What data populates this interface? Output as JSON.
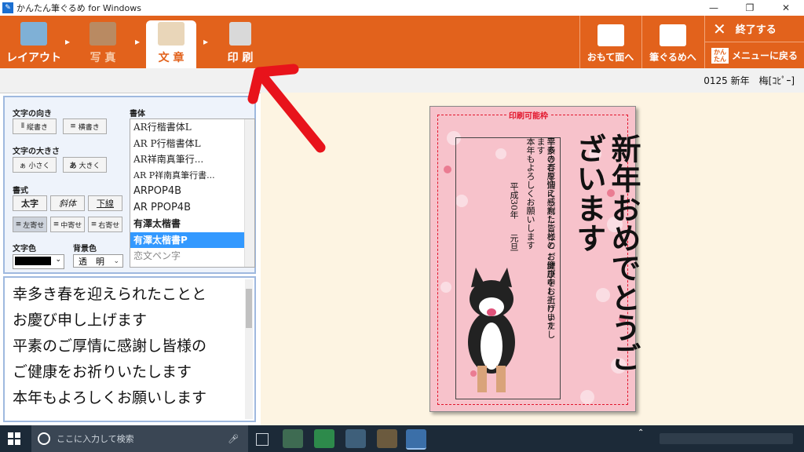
{
  "window": {
    "title": "かんたん筆ぐるめ for Windows",
    "controls": [
      "—",
      "❐",
      "✕"
    ]
  },
  "toolbar": {
    "tabs": [
      {
        "label": "レイアウト",
        "state": "normal"
      },
      {
        "label": "写 真",
        "state": "dim"
      },
      {
        "label": "文 章",
        "state": "active"
      },
      {
        "label": "印 刷",
        "state": "normal"
      }
    ],
    "right_buttons": {
      "front": "おもて面へ",
      "fude": "筆ぐるめへ",
      "exit": "終了する",
      "menu_badge": "かんたん",
      "menu": "メニューに戻る"
    }
  },
  "status": {
    "doc_name": "0125 新年　梅[ｺﾋﾟｰ]"
  },
  "left_panel": {
    "direction_label": "文字の向き",
    "vertical": "縦書き",
    "horizontal": "横書き",
    "size_label": "文字の大きさ",
    "smaller": "小さく",
    "larger": "大きく",
    "style_label": "書式",
    "bold": "太字",
    "italic": "斜体",
    "underline": "下線",
    "align_left": "左寄せ",
    "align_center": "中寄せ",
    "align_right": "右寄せ",
    "color_label": "文字色",
    "bg_label": "背景色",
    "bg_value": "透　明",
    "font_label": "書体",
    "fonts": [
      "AR行楷書体L",
      "AR P行楷書体L",
      "AR祥南真筆行...",
      "AR P祥南真筆行書...",
      "ARPOP4B",
      "AR PPOP4B",
      "有澤太楷書",
      "有澤太楷書P",
      "恋文ペン字"
    ],
    "selected_font_index": 7
  },
  "editor": {
    "lines": [
      "幸多き春を迎えられたことと",
      "お慶び申し上げます",
      "平素のご厚情に感謝し皆様の",
      "ご健康をお祈りいたします",
      "本年もよろしくお願いします"
    ]
  },
  "card": {
    "print_label": "印刷可能枠",
    "greeting": "新年おめでとうございます",
    "date": "平成30年",
    "gantan": "元旦",
    "body_lines": [
      "幸多き春を迎えられたことと お慶び申し上げます",
      "平素のご厚情に感謝し皆様の ご健康をお祈りいたします",
      "本年もよろしくお願いします"
    ]
  },
  "taskbar": {
    "search_placeholder": "ここに入力して検索"
  },
  "colors": {
    "accent_orange": "#e2621c",
    "selection_blue": "#3399ff",
    "canvas_bg": "#fdf4e2",
    "card_pink": "#f7c2cb",
    "print_frame_red": "#e2162c"
  }
}
